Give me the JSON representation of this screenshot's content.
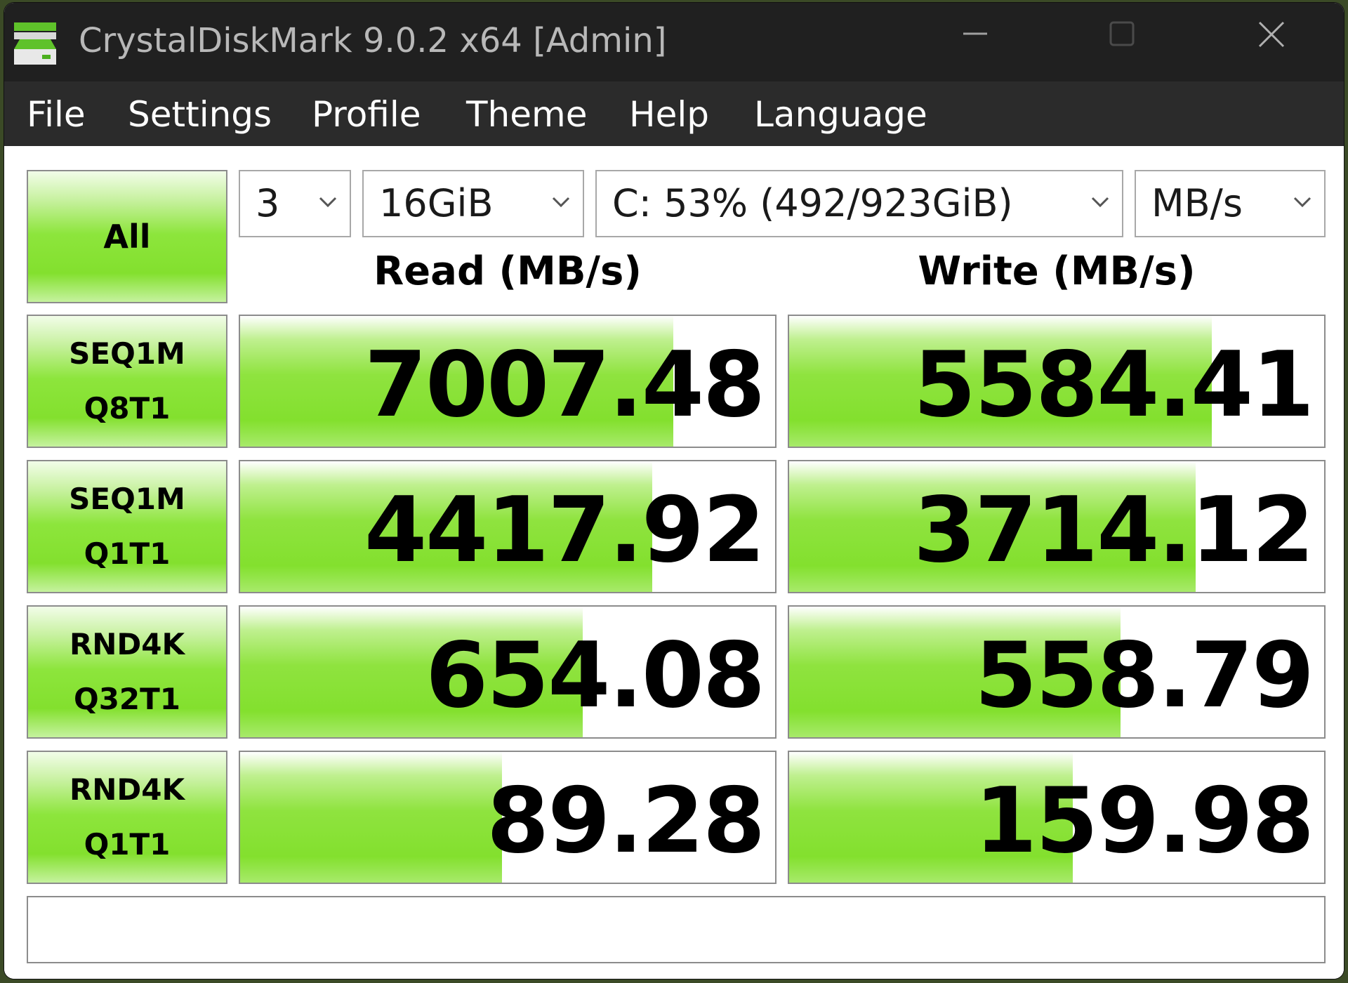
{
  "window": {
    "title": "CrystalDiskMark 9.0.2 x64 [Admin]",
    "icons": {
      "app": "disk-drive-icon",
      "minimize": "minimize-icon",
      "maximize": "maximize-icon",
      "close": "close-icon"
    }
  },
  "menu": [
    "File",
    "Settings",
    "Profile",
    "Theme",
    "Help",
    "Language"
  ],
  "controls": {
    "all_label": "All",
    "count": "3",
    "size": "16GiB",
    "drive": "C: 53% (492/923GiB)",
    "unit": "MB/s"
  },
  "headers": {
    "read": "Read (MB/s)",
    "write": "Write (MB/s)"
  },
  "tests": [
    {
      "line1": "SEQ1M",
      "line2": "Q8T1",
      "read": "7007.48",
      "write": "5584.41",
      "read_fraction": 0.81,
      "write_fraction": 0.79
    },
    {
      "line1": "SEQ1M",
      "line2": "Q1T1",
      "read": "4417.92",
      "write": "3714.12",
      "read_fraction": 0.77,
      "write_fraction": 0.76
    },
    {
      "line1": "RND4K",
      "line2": "Q32T1",
      "read": "654.08",
      "write": "558.79",
      "read_fraction": 0.64,
      "write_fraction": 0.62
    },
    {
      "line1": "RND4K",
      "line2": "Q1T1",
      "read": "89.28",
      "write": "159.98",
      "read_fraction": 0.49,
      "write_fraction": 0.53
    }
  ],
  "comment": "",
  "colors": {
    "bar_green": "#83e02e",
    "title_bar": "#202020",
    "menu_bar": "#2b2b2b"
  }
}
